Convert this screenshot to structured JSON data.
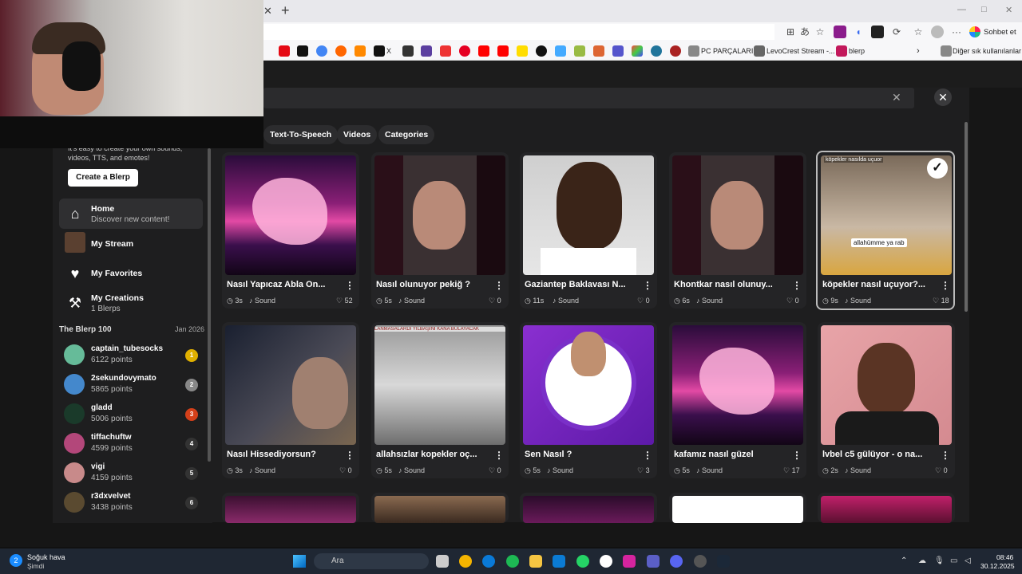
{
  "browser": {
    "bookmarks": [
      "X",
      "PC PARÇALARI",
      "LevoCrest Stream -...",
      "blerp"
    ],
    "other_bookmarks": "Diğer sık kullanılanlar",
    "copilot_label": "Sohbet et"
  },
  "filters": [
    "Text-To-Speech",
    "Videos",
    "Categories"
  ],
  "sidebar": {
    "promo_text": "It's easy to create your own sounds, videos, TTS, and emotes!",
    "create_button": "Create a Blerp",
    "nav": [
      {
        "label": "Home",
        "sub": "Discover new content!",
        "icon": "home-icon"
      },
      {
        "label": "My Stream",
        "sub": "",
        "icon": "stream-avatar"
      },
      {
        "label": "My Favorites",
        "sub": "",
        "icon": "heart-icon"
      },
      {
        "label": "My Creations",
        "sub": "1 Blerps",
        "icon": "hammer-icon"
      }
    ],
    "blerp100_title": "The Blerp 100",
    "blerp100_date": "Jan 2026",
    "leaders": [
      {
        "name": "captain_tubesocks",
        "points": "6122 points",
        "rank": "1"
      },
      {
        "name": "2sekundovymato",
        "points": "5865 points",
        "rank": "2"
      },
      {
        "name": "gladd",
        "points": "5006 points",
        "rank": "3"
      },
      {
        "name": "tiffachuftw",
        "points": "4599 points",
        "rank": "4"
      },
      {
        "name": "vigi",
        "points": "4159 points",
        "rank": "5"
      },
      {
        "name": "r3dxvelvet",
        "points": "3438 points",
        "rank": "6"
      }
    ]
  },
  "cards": [
    {
      "title": "Nasıl Yapıcaz Abla On...",
      "duration": "3s",
      "type": "Sound",
      "likes": "52"
    },
    {
      "title": "Nasıl olunuyor pekiğ ?",
      "duration": "5s",
      "type": "Sound",
      "likes": "0"
    },
    {
      "title": "Gaziantep Baklavası N...",
      "duration": "11s",
      "type": "Sound",
      "likes": "0"
    },
    {
      "title": "Khontkar nasıl olunuy...",
      "duration": "6s",
      "type": "Sound",
      "likes": "0"
    },
    {
      "title": "köpekler nasıl uçuyor?...",
      "duration": "9s",
      "type": "Sound",
      "likes": "18",
      "caption_top": "köpekler nasılda uçuor",
      "caption_bottom": "allahümme ya rab"
    },
    {
      "title": "Nasıl Hissediyorsun?",
      "duration": "3s",
      "type": "Sound",
      "likes": "0"
    },
    {
      "title": "allahsızlar kopekler oç...",
      "duration": "5s",
      "type": "Sound",
      "likes": "0",
      "caption_top": "LANMASALARDI YILBAŞINI KANA BULAYACAK"
    },
    {
      "title": "Sen Nasıl ?",
      "duration": "5s",
      "type": "Sound",
      "likes": "3"
    },
    {
      "title": "kafamız nasıl güzel",
      "duration": "5s",
      "type": "Sound",
      "likes": "17"
    },
    {
      "title": "lvbel c5 gülüyor - o na...",
      "duration": "2s",
      "type": "Sound",
      "likes": "0"
    }
  ],
  "taskbar": {
    "weather_badge": "2",
    "weather_title": "Soğuk hava",
    "weather_sub": "Şimdi",
    "search_placeholder": "Ara",
    "time": "08:46",
    "date": "30.12.2025"
  }
}
